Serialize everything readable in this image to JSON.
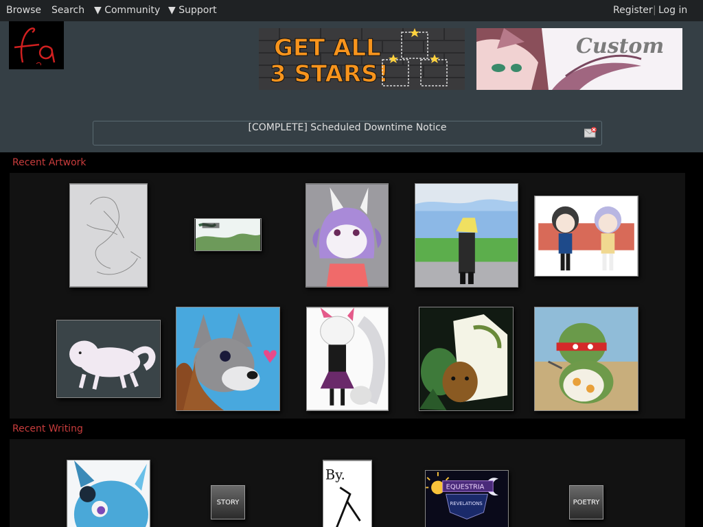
{
  "nav": {
    "browse": "Browse",
    "search": "Search",
    "community": "▼ Community",
    "support": "▼ Support",
    "register": "Register",
    "separator": "|",
    "login": "Log in"
  },
  "header": {
    "banner1_line1": "GET ALL",
    "banner1_line2": "3 STARS!",
    "banner2_text": "Custom"
  },
  "notice": {
    "text": "[COMPLETE] Scheduled Downtime Notice"
  },
  "sections": {
    "recent_artwork": "Recent Artwork",
    "recent_writing": "Recent Writing"
  },
  "writing": {
    "story_label": "STORY",
    "poetry_label": "POETRY",
    "byline": "By.",
    "equestria_line1": "EQUESTRIA",
    "equestria_line2": "REVELATIONS"
  },
  "colors": {
    "accent": "#c83c3c",
    "nav_bg": "#1f2224",
    "header_bg": "#353f45"
  }
}
